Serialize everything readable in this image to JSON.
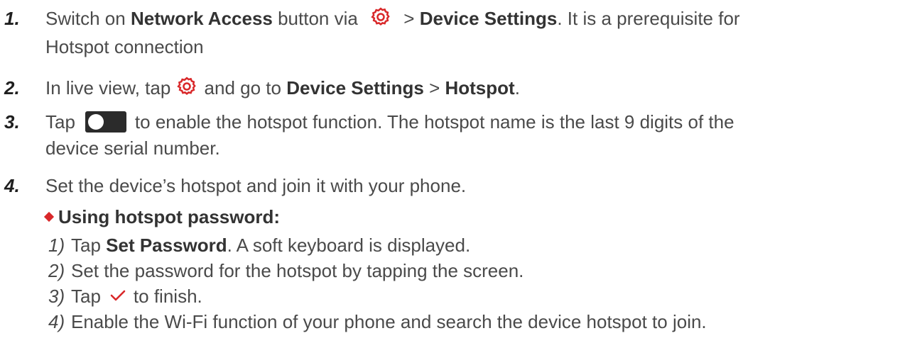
{
  "steps": [
    {
      "num": "1.",
      "line1_pre": "Switch on ",
      "line1_bold1": "Network Access",
      "line1_mid": " button via ",
      "line1_gt": " > ",
      "line1_bold2": "Device Settings",
      "line1_post": ". It is a prerequisite for",
      "line2": "Hotspot connection"
    },
    {
      "num": "2.",
      "pre": "In live view, tap ",
      "mid": "and go to ",
      "bold1": "Device Settings",
      "gt": " > ",
      "bold2": "Hotspot",
      "post": "."
    },
    {
      "num": "3.",
      "pre": "Tap",
      "post": "to enable the hotspot function. The hotspot name is the last 9 digits of the",
      "line2": "device serial number."
    },
    {
      "num": "4.",
      "text": "Set the device’s hotspot and join it with your phone."
    }
  ],
  "bullet": {
    "heading": "Using hotspot password:"
  },
  "substeps": [
    {
      "num": "1)",
      "pre": "Tap ",
      "bold": "Set Password",
      "post": ". A soft keyboard is displayed."
    },
    {
      "num": "2)",
      "text": "Set the password for the hotspot by tapping the screen."
    },
    {
      "num": "3)",
      "pre": "Tap",
      "post": "to finish."
    },
    {
      "num": "4)",
      "text": "Enable the Wi-Fi function of your phone and search the device hotspot to join."
    }
  ],
  "colors": {
    "accent_red": "#d9282a",
    "text": "#4a4a4a",
    "toggle_bg": "#2b2b2b"
  },
  "icons": {
    "settings": "gear-icon",
    "toggle": "toggle-switch-icon",
    "confirm": "checkmark-icon",
    "bullet": "diamond-bullet-icon"
  }
}
